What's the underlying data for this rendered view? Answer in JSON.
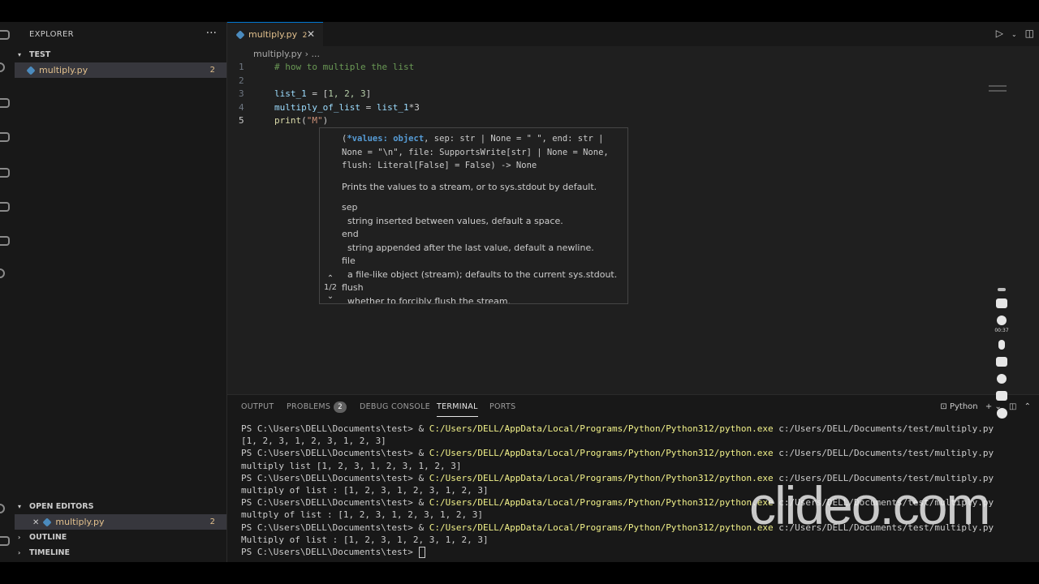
{
  "sidebar": {
    "title": "EXPLORER",
    "more": "···",
    "folder": "TEST",
    "file": {
      "name": "multiply.py",
      "problems": "2"
    },
    "open_editors": {
      "title": "OPEN EDITORS",
      "close": "✕",
      "file": "multiply.py",
      "problems": "2"
    },
    "outline": "OUTLINE",
    "timeline": "TIMELINE"
  },
  "tab": {
    "name": "multiply.py",
    "count": "2",
    "close": "✕"
  },
  "breadcrumb": {
    "file": "multiply.py",
    "sep": "›",
    "rest": "..."
  },
  "editor": {
    "line_numbers": [
      "1",
      "2",
      "3",
      "4",
      "5"
    ],
    "comment": "# how to multiple the list",
    "l3_var": "list_1",
    "l3_op": " = [",
    "l3_nums": "1, 2, 3",
    "l3_end": "]",
    "l4_var": "multiply_of_list",
    "l4_op": " = ",
    "l4_var2": "list_1",
    "l4_end": "*3",
    "l5_fn": "print",
    "l5_open": "(",
    "l5_str": "\"M\"",
    "l5_close": ")"
  },
  "hover": {
    "sig_lead": "(",
    "sig_kw": "*values: object",
    "sig_rest": ", sep: str | None = \" \", end: str | None = \"\\n\", file: SupportsWrite[str] | None = None, flush: Literal[False] = False) -> None",
    "desc": "Prints the values to a stream, or to sys.stdout by default.",
    "params": [
      "sep",
      "  string inserted between values, default a space.",
      "end",
      "  string appended after the last value, default a newline.",
      "file",
      "  a file-like object (stream); defaults to the current sys.stdout.",
      "flush",
      "  whether to forcibly flush the stream."
    ],
    "pager": "1/2"
  },
  "panel": {
    "tabs": [
      "OUTPUT",
      "PROBLEMS",
      "DEBUG CONSOLE",
      "TERMINAL",
      "PORTS"
    ],
    "problems_count": "2",
    "shell": "Python"
  },
  "terminal": {
    "prompt": "PS C:\\Users\\DELL\\Documents\\test> ",
    "cmd_amp": "& ",
    "cmd_exe": "C:/Users/DELL/AppData/Local/Programs/Python/Python312/python.exe",
    "cmd_arg": " c:/Users/DELL/Documents/test/multiply.py",
    "outputs": [
      "[1, 2, 3, 1, 2, 3, 1, 2, 3]",
      "multiply list [1, 2, 3, 1, 2, 3, 1, 2, 3]",
      "multiply of list : [1, 2, 3, 1, 2, 3, 1, 2, 3]",
      "multply of list : [1, 2, 3, 1, 2, 3, 1, 2, 3]",
      "Multiply of list : [1, 2, 3, 1, 2, 3, 1, 2, 3]"
    ]
  },
  "recorder": {
    "time": "00:37"
  },
  "watermark": "clideo.com",
  "colors": {
    "accent": "#0078d4",
    "modified": "#e2c08d",
    "path": "#f2f28a",
    "comment": "#6a9955"
  }
}
